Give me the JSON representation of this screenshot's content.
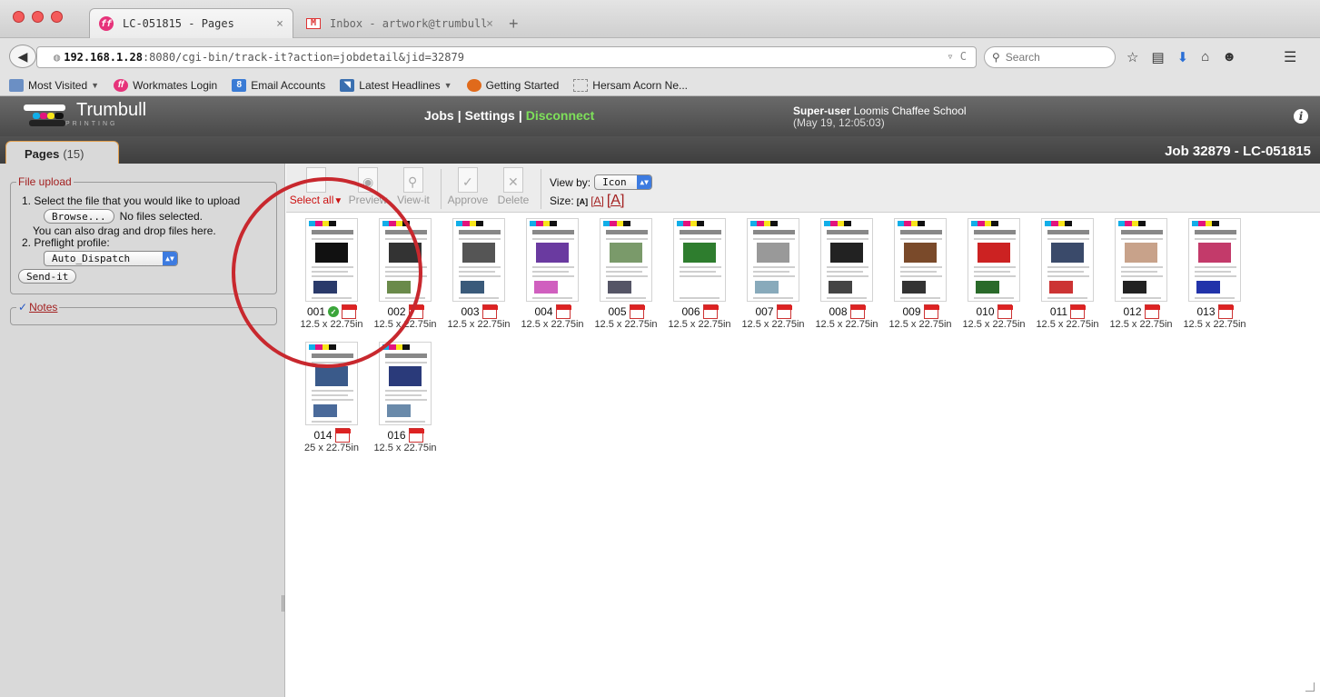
{
  "browser": {
    "tabs": [
      {
        "title": "LC-051815 - Pages",
        "close": "×"
      },
      {
        "title": "Inbox - artwork@trumbull...",
        "close": "×"
      }
    ],
    "new_tab": "+",
    "url_host": "192.168.1.28",
    "url_rest": ":8080/cgi-bin/track-it?action=jobdetail&jid=32879",
    "search_placeholder": "Search",
    "bookmarks": [
      {
        "label": "Most Visited",
        "icon": "folder-icon",
        "has_menu": true
      },
      {
        "label": "Workmates Login",
        "icon": "workmates-icon",
        "has_menu": false
      },
      {
        "label": "Email Accounts",
        "icon": "accounts-icon",
        "has_menu": false
      },
      {
        "label": "Latest Headlines",
        "icon": "rss-icon",
        "has_menu": true
      },
      {
        "label": "Getting Started",
        "icon": "firefox-icon",
        "has_menu": false
      },
      {
        "label": "Hersam Acorn Ne...",
        "icon": "blank-page-icon",
        "has_menu": false
      }
    ]
  },
  "app": {
    "logo_name": "Trumbull",
    "logo_sub": "PRINTING",
    "menu": {
      "jobs": "Jobs",
      "settings": "Settings",
      "disconnect": "Disconnect",
      "separator": "|"
    },
    "user_role": "Super-user",
    "user_school": "Loomis Chaffee School",
    "user_date": "(May 19, 12:05:03)",
    "info_glyph": "i",
    "colors": {
      "disconnect": "#7ee05a",
      "accent_red": "#a32020",
      "header_bg": "#5a5a5a"
    }
  },
  "tabstrip": {
    "pages_label": "Pages",
    "pages_count": "(15)",
    "job_title": "Job 32879 - LC-051815"
  },
  "sidebar": {
    "upload_legend": "File upload",
    "step1": "1. Select the file that you would like to upload",
    "browse_label": "Browse...",
    "no_files": "No files selected.",
    "drag_drop": "You can also drag and drop files here.",
    "step2": "2. Preflight profile:",
    "profile_value": "Auto_Dispatch",
    "send_label": "Send-it",
    "notes_check": "✓",
    "notes_label": "Notes"
  },
  "toolbar": {
    "select_all": "Select all",
    "preview": "Preview",
    "view_it": "View-it",
    "approve": "Approve",
    "delete": "Delete",
    "view_by_label": "View by:",
    "view_by_value": "Icon",
    "size_label": "Size:",
    "size_small": "[A]",
    "size_medium": "[A]",
    "size_large": "[A]"
  },
  "pages": [
    {
      "num": "001",
      "dim": "12.5 x 22.75in",
      "approved": true
    },
    {
      "num": "002",
      "dim": "12.5 x 22.75in",
      "approved": false
    },
    {
      "num": "003",
      "dim": "12.5 x 22.75in",
      "approved": false
    },
    {
      "num": "004",
      "dim": "12.5 x 22.75in",
      "approved": false
    },
    {
      "num": "005",
      "dim": "12.5 x 22.75in",
      "approved": false
    },
    {
      "num": "006",
      "dim": "12.5 x 22.75in",
      "approved": false
    },
    {
      "num": "007",
      "dim": "12.5 x 22.75in",
      "approved": false
    },
    {
      "num": "008",
      "dim": "12.5 x 22.75in",
      "approved": false
    },
    {
      "num": "009",
      "dim": "12.5 x 22.75in",
      "approved": false
    },
    {
      "num": "010",
      "dim": "12.5 x 22.75in",
      "approved": false
    },
    {
      "num": "011",
      "dim": "12.5 x 22.75in",
      "approved": false
    },
    {
      "num": "012",
      "dim": "12.5 x 22.75in",
      "approved": false
    },
    {
      "num": "013",
      "dim": "12.5 x 22.75in",
      "approved": false
    },
    {
      "num": "014",
      "dim": "25 x 22.75in",
      "approved": false
    },
    {
      "num": "016",
      "dim": "12.5 x 22.75in",
      "approved": false
    }
  ]
}
